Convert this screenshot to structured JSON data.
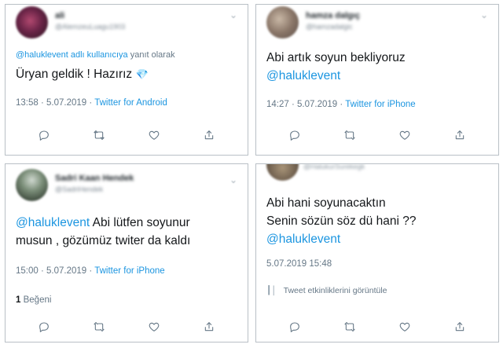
{
  "tweets": [
    {
      "name": "ali",
      "handle": "@AlemzeuLuagu1903",
      "reply_prefix": "@halukleventadlı kullanıcıya",
      "reply_mention": "@haluklevent adlı kullanıcıya",
      "reply_suffix": "yanıt olarak",
      "text": "Üryan geldik ! Hazırız",
      "emoji": "💎",
      "time": "13:58 · 5.07.2019 ·",
      "source": "Twitter for Android"
    },
    {
      "name": "hamza dalgıç",
      "handle": "@hamzadalgic",
      "text_line1": "Abi artık soyun bekliyoruz",
      "mention": "@haluklevent",
      "time": "14:27 · 5.07.2019 ·",
      "source": "Twitter for iPhone"
    },
    {
      "name": "Sadri Kaan Hendek",
      "handle": "@SadriHendek",
      "mention": "@haluklevent",
      "text_line1_rest": "Abi lütfen soyunur",
      "text_line2": "musun , gözümüz twiter da kaldı",
      "time": "15:00 · 5.07.2019 ·",
      "source": "Twitter for iPhone",
      "like_count": "1",
      "like_label": "Beğeni"
    },
    {
      "handle": "@HalukurSurekegk",
      "text_line1": "Abi hani soyunacaktın",
      "text_line2": "Senin sözün söz dü hani ??",
      "mention": "@haluklevent",
      "time": "5.07.2019 15:48",
      "activity": "Tweet etkinliklerini görüntüle"
    }
  ],
  "icons": {
    "reply": "reply-icon",
    "retweet": "retweet-icon",
    "like": "heart-icon",
    "share": "share-icon",
    "more": "chevron-down-icon"
  },
  "colors": {
    "link": "#1b95e0",
    "muted": "#657786",
    "text": "#14171a",
    "border": "#b9c0c6"
  }
}
